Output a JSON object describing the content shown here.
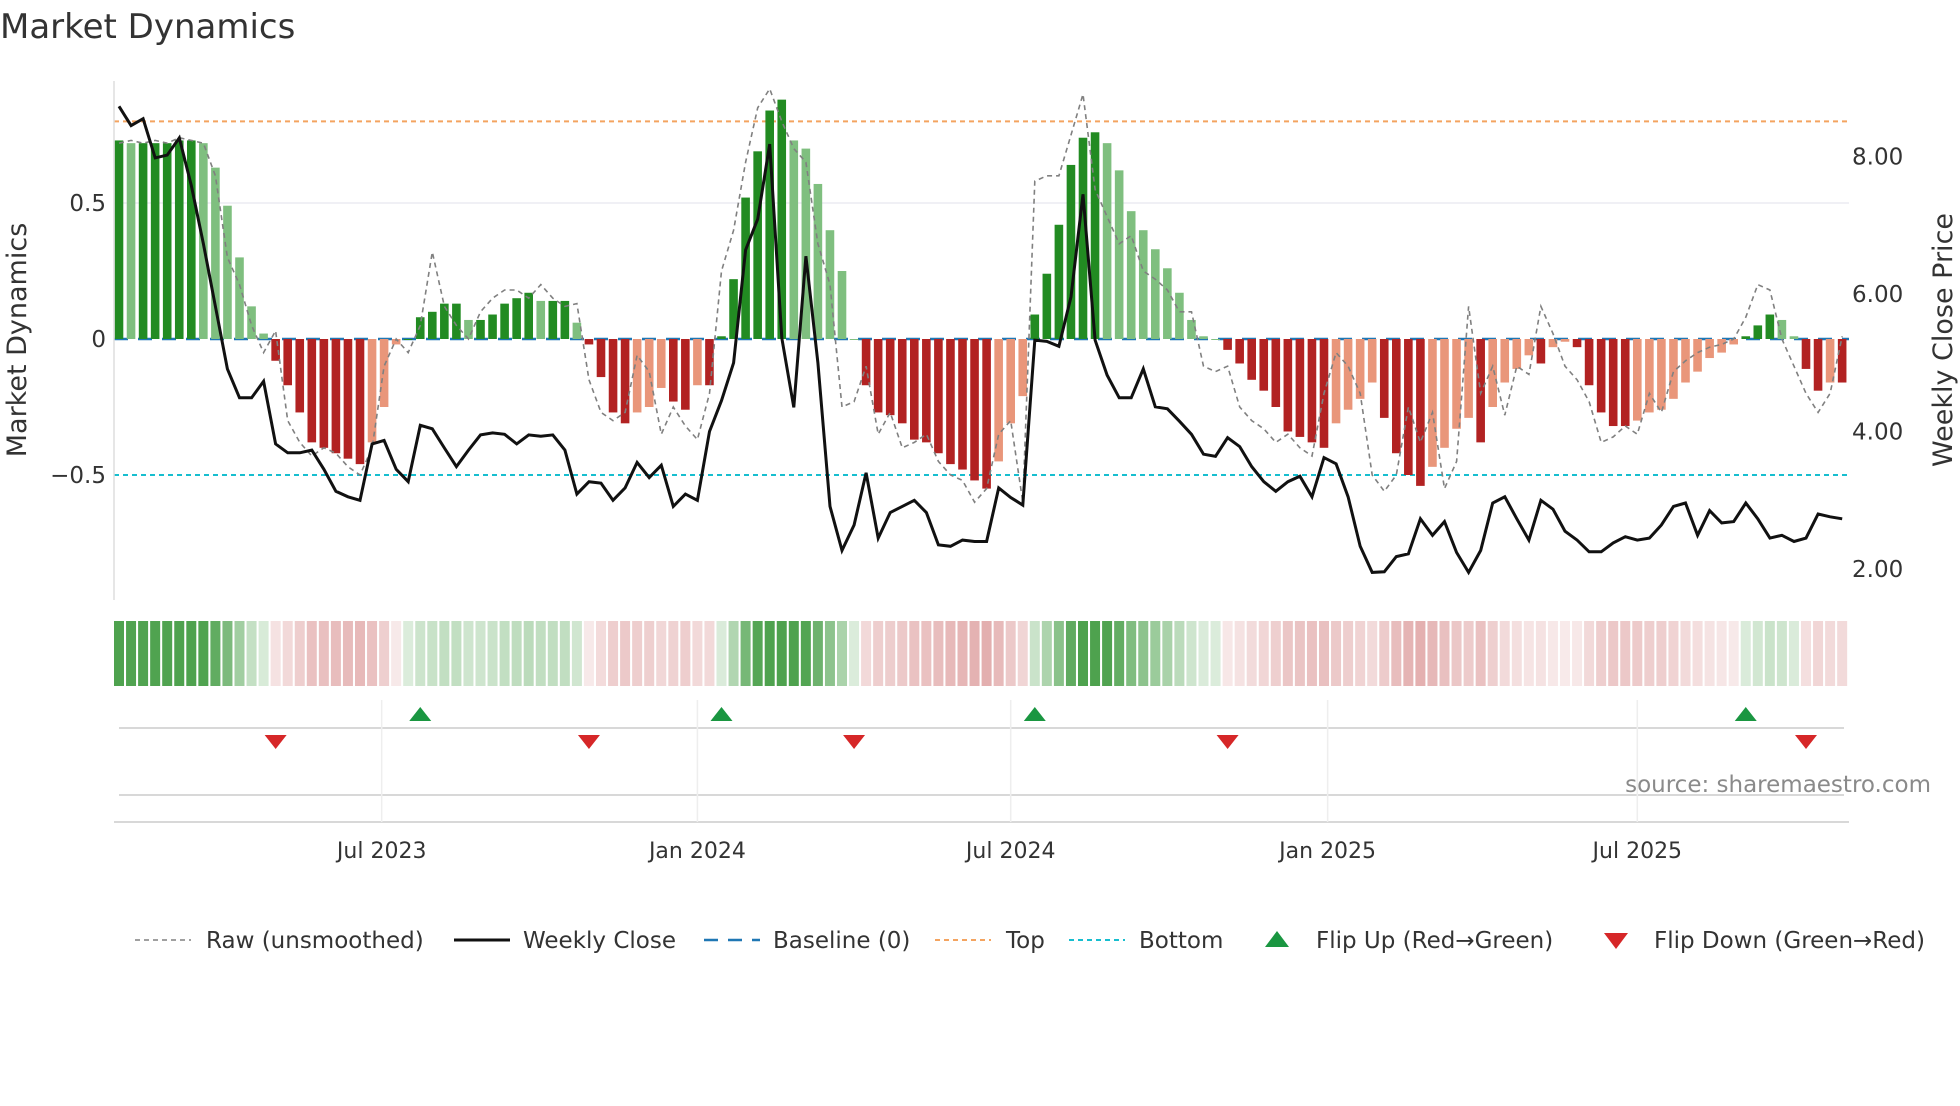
{
  "chart_data": {
    "type": "bar",
    "title": "Market Dynamics",
    "ylabel": "Market Dynamics",
    "y2label": "Weekly Close Price",
    "ylim": [
      -0.95,
      0.95
    ],
    "y2lim": [
      1.5,
      9.3
    ],
    "yticks": [
      {
        "v": 0.5,
        "label": "0.5"
      },
      {
        "v": 0,
        "label": "0"
      },
      {
        "v": -0.5,
        "label": "−0.5"
      }
    ],
    "y2ticks": [
      {
        "v": 8,
        "label": "8.00"
      },
      {
        "v": 6,
        "label": "6.00"
      },
      {
        "v": 4,
        "label": "4.00"
      },
      {
        "v": 2,
        "label": "2.00"
      }
    ],
    "xticks": [
      {
        "week": 21.8,
        "label": "Jul 2023"
      },
      {
        "week": 48,
        "label": "Jan 2024"
      },
      {
        "week": 74,
        "label": "Jul 2024"
      },
      {
        "week": 100.3,
        "label": "Jan 2025"
      },
      {
        "week": 126,
        "label": "Jul 2025"
      }
    ],
    "levels": {
      "top": 0.8,
      "bottom": -0.5,
      "baseline": 0
    },
    "smoothed": [
      0.73,
      0.72,
      0.72,
      0.72,
      0.72,
      0.73,
      0.73,
      0.72,
      0.63,
      0.49,
      0.3,
      0.12,
      0.02,
      -0.08,
      -0.17,
      -0.27,
      -0.38,
      -0.4,
      -0.42,
      -0.44,
      -0.46,
      -0.38,
      -0.25,
      -0.02,
      0.0,
      0.08,
      0.1,
      0.13,
      0.13,
      0.07,
      0.07,
      0.09,
      0.13,
      0.15,
      0.17,
      0.14,
      0.14,
      0.14,
      0.06,
      -0.02,
      -0.14,
      -0.27,
      -0.31,
      -0.27,
      -0.25,
      -0.18,
      -0.23,
      -0.26,
      -0.17,
      -0.17,
      0.01,
      0.22,
      0.52,
      0.69,
      0.84,
      0.88,
      0.73,
      0.7,
      0.57,
      0.4,
      0.25,
      0.0,
      -0.17,
      -0.27,
      -0.28,
      -0.31,
      -0.37,
      -0.38,
      -0.42,
      -0.46,
      -0.48,
      -0.52,
      -0.55,
      -0.45,
      -0.31,
      -0.21,
      0.09,
      0.24,
      0.42,
      0.64,
      0.74,
      0.76,
      0.72,
      0.62,
      0.47,
      0.4,
      0.33,
      0.26,
      0.17,
      0.07,
      0.01,
      0.0,
      -0.04,
      -0.09,
      -0.15,
      -0.19,
      -0.25,
      -0.34,
      -0.36,
      -0.38,
      -0.4,
      -0.31,
      -0.26,
      -0.22,
      -0.16,
      -0.29,
      -0.42,
      -0.5,
      -0.54,
      -0.47,
      -0.4,
      -0.33,
      -0.29,
      -0.38,
      -0.25,
      -0.16,
      -0.11,
      -0.06,
      -0.09,
      -0.03,
      -0.01,
      -0.03,
      -0.17,
      -0.27,
      -0.32,
      -0.32,
      -0.3,
      -0.27,
      -0.26,
      -0.22,
      -0.16,
      -0.12,
      -0.07,
      -0.05,
      -0.02,
      0.01,
      0.05,
      0.09,
      0.07,
      0.01,
      -0.11,
      -0.19,
      -0.16,
      -0.16
    ],
    "raw": [
      0.72,
      0.73,
      0.72,
      0.73,
      0.72,
      0.74,
      0.73,
      0.72,
      0.6,
      0.3,
      0.2,
      0.05,
      -0.05,
      0.03,
      -0.3,
      -0.38,
      -0.43,
      -0.4,
      -0.42,
      -0.47,
      -0.5,
      -0.4,
      -0.1,
      0.0,
      -0.05,
      0.05,
      0.32,
      0.12,
      0.05,
      0.0,
      0.1,
      0.15,
      0.18,
      0.18,
      0.15,
      0.2,
      0.15,
      0.12,
      0.13,
      -0.15,
      -0.27,
      -0.3,
      -0.27,
      -0.06,
      -0.12,
      -0.35,
      -0.25,
      -0.32,
      -0.37,
      -0.2,
      0.25,
      0.4,
      0.65,
      0.85,
      0.92,
      0.8,
      0.7,
      0.65,
      0.35,
      0.2,
      -0.25,
      -0.23,
      -0.1,
      -0.35,
      -0.27,
      -0.4,
      -0.38,
      -0.35,
      -0.45,
      -0.5,
      -0.52,
      -0.6,
      -0.55,
      -0.35,
      -0.3,
      -0.6,
      0.58,
      0.6,
      0.6,
      0.75,
      0.9,
      0.55,
      0.45,
      0.35,
      0.38,
      0.25,
      0.22,
      0.18,
      0.1,
      0.1,
      -0.1,
      -0.12,
      -0.1,
      -0.25,
      -0.3,
      -0.33,
      -0.38,
      -0.35,
      -0.4,
      -0.43,
      -0.2,
      -0.05,
      -0.1,
      -0.2,
      -0.5,
      -0.56,
      -0.5,
      -0.25,
      -0.38,
      -0.27,
      -0.55,
      -0.45,
      0.12,
      -0.2,
      -0.1,
      -0.28,
      -0.1,
      -0.13,
      0.12,
      0.02,
      -0.1,
      -0.15,
      -0.23,
      -0.38,
      -0.36,
      -0.32,
      -0.35,
      -0.2,
      -0.27,
      -0.12,
      -0.08,
      -0.05,
      -0.03,
      -0.02,
      0.0,
      0.08,
      0.2,
      0.18,
      0.0,
      -0.1,
      -0.2,
      -0.27,
      -0.2,
      0.01
    ],
    "close": [
      8.73,
      8.45,
      8.55,
      7.98,
      8.02,
      8.27,
      7.58,
      6.73,
      5.82,
      4.91,
      4.49,
      4.49,
      4.73,
      3.82,
      3.69,
      3.69,
      3.73,
      3.45,
      3.13,
      3.05,
      3.0,
      3.82,
      3.87,
      3.45,
      3.27,
      4.09,
      4.04,
      3.76,
      3.49,
      3.73,
      3.95,
      3.98,
      3.96,
      3.82,
      3.95,
      3.93,
      3.95,
      3.73,
      3.09,
      3.27,
      3.25,
      3.0,
      3.18,
      3.55,
      3.33,
      3.51,
      2.91,
      3.09,
      3.0,
      4.0,
      4.45,
      5.0,
      6.64,
      7.09,
      8.18,
      5.36,
      4.35,
      6.55,
      5.0,
      2.91,
      2.27,
      2.64,
      3.4,
      2.45,
      2.82,
      2.91,
      3.0,
      2.82,
      2.35,
      2.33,
      2.42,
      2.4,
      2.4,
      3.18,
      3.04,
      2.93,
      5.33,
      5.31,
      5.24,
      5.96,
      7.45,
      5.33,
      4.82,
      4.49,
      4.49,
      4.91,
      4.36,
      4.33,
      4.15,
      3.96,
      3.67,
      3.64,
      3.91,
      3.78,
      3.49,
      3.27,
      3.13,
      3.27,
      3.35,
      3.05,
      3.62,
      3.53,
      3.05,
      2.33,
      1.95,
      1.96,
      2.18,
      2.22,
      2.73,
      2.49,
      2.69,
      2.24,
      1.95,
      2.27,
      2.96,
      3.05,
      2.73,
      2.42,
      3.0,
      2.87,
      2.55,
      2.42,
      2.25,
      2.25,
      2.38,
      2.47,
      2.42,
      2.45,
      2.64,
      2.91,
      2.96,
      2.49,
      2.85,
      2.67,
      2.69,
      2.96,
      2.73,
      2.45,
      2.49,
      2.4,
      2.45,
      2.8,
      2.76,
      2.73
    ],
    "flip_up_weeks": [
      25,
      50,
      76,
      135
    ],
    "flip_down_weeks": [
      13,
      39,
      61,
      92,
      140
    ],
    "legend": [
      "Raw (unsmoothed)",
      "Weekly Close",
      "Baseline (0)",
      "Top",
      "Bottom",
      "Flip Up (Red→Green)",
      "Flip Down (Green→Red)"
    ],
    "legend_placement": "bottom",
    "colors": {
      "pos_rising": "#228b22",
      "pos_falling": "#7fbf7f",
      "neg_falling": "#b22222",
      "neg_rising": "#e9967a",
      "top": "#f4a460",
      "bottom": "#17becf",
      "baseline": "#1f77b4",
      "raw": "#808080",
      "close": "#111111",
      "flip_up": "#1a9641",
      "flip_down": "#d62728"
    }
  },
  "header": {
    "title": "Market Dynamics"
  },
  "source": "source: sharemaestro.com"
}
